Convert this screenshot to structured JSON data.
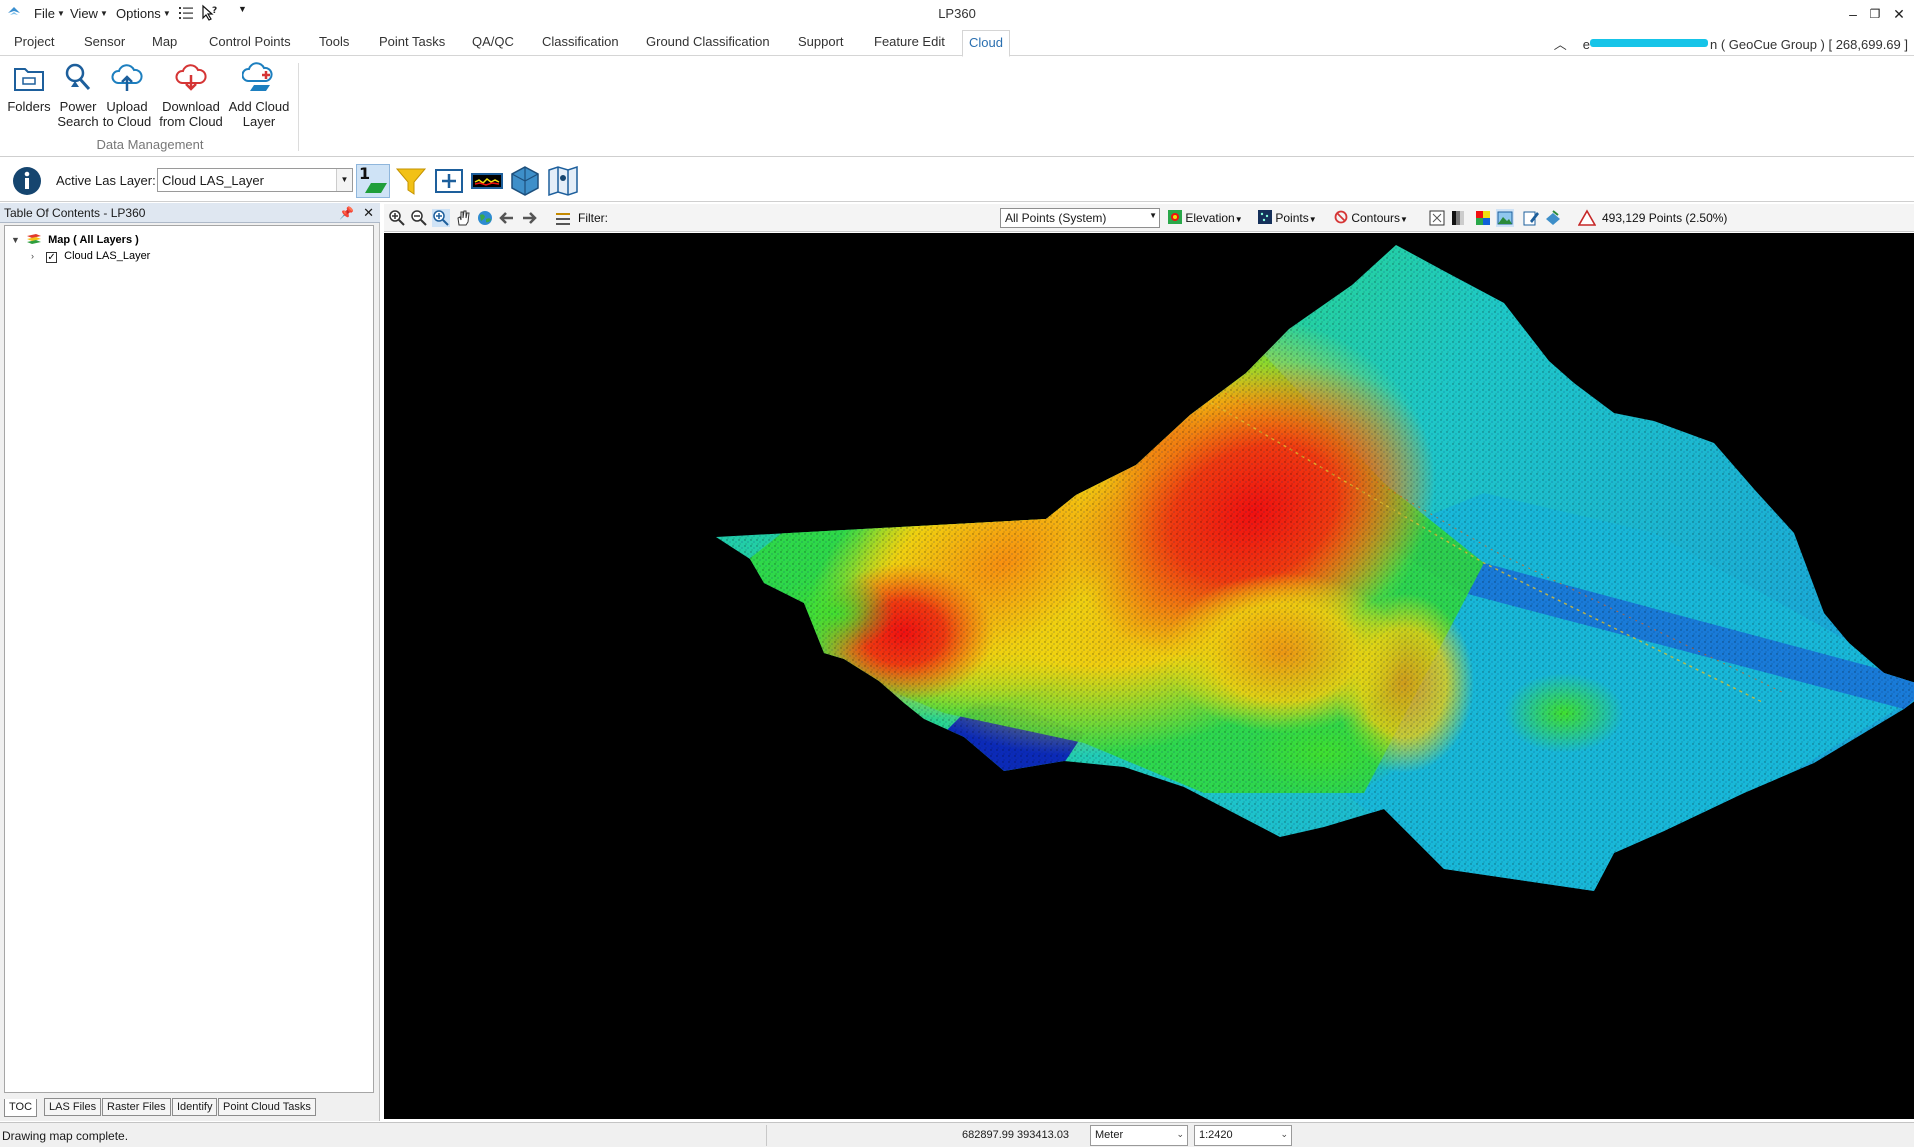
{
  "app": {
    "title": "LP360"
  },
  "quick_menu": {
    "file": "File",
    "view": "View",
    "options": "Options"
  },
  "ribbon": {
    "tabs": [
      "Project",
      "Sensor",
      "Map",
      "Control Points",
      "Tools",
      "Point Tasks",
      "QA/QC",
      "Classification",
      "Ground Classification",
      "Support",
      "Feature Edit",
      "Cloud"
    ],
    "active_tab": "Cloud",
    "user_prefix": "e",
    "user_suffix": "n ( GeoCue Group ) [ 268,699.69 ]",
    "buttons": [
      {
        "label1": "Folders",
        "label2": ""
      },
      {
        "label1": "Power",
        "label2": "Search"
      },
      {
        "label1": "Upload",
        "label2": "to Cloud"
      },
      {
        "label1": "Download",
        "label2": "from Cloud"
      },
      {
        "label1": "Add Cloud",
        "label2": "Layer"
      }
    ],
    "group_label": "Data Management"
  },
  "las_toolbar": {
    "label": "Active Las Layer:",
    "value": "Cloud LAS_Layer",
    "layer_number": "1"
  },
  "toc": {
    "header": "Table Of Contents - LP360",
    "root": "Map ( All Layers )",
    "layer": "Cloud LAS_Layer",
    "tabs": [
      "TOC",
      "LAS Files",
      "Raster Files",
      "Identify",
      "Point Cloud Tasks"
    ]
  },
  "map_toolbar": {
    "filter_label": "Filter:",
    "filter_value": "All Points (System)",
    "elevation": "Elevation",
    "points": "Points",
    "contours": "Contours",
    "point_count": "493,129 Points (2.50%)"
  },
  "status": {
    "message": "Drawing map complete.",
    "coords": "682897.99 393413.03",
    "unit": "Meter",
    "scale": "1:2420"
  },
  "colors": {
    "accent": "#2a6fb0",
    "map_background": "#000000",
    "elevation_ramp": [
      "#0a1aa0",
      "#1060d8",
      "#18b4e0",
      "#10d8b0",
      "#20e040",
      "#a8e818",
      "#f0e010",
      "#f89010",
      "#f01010"
    ]
  }
}
